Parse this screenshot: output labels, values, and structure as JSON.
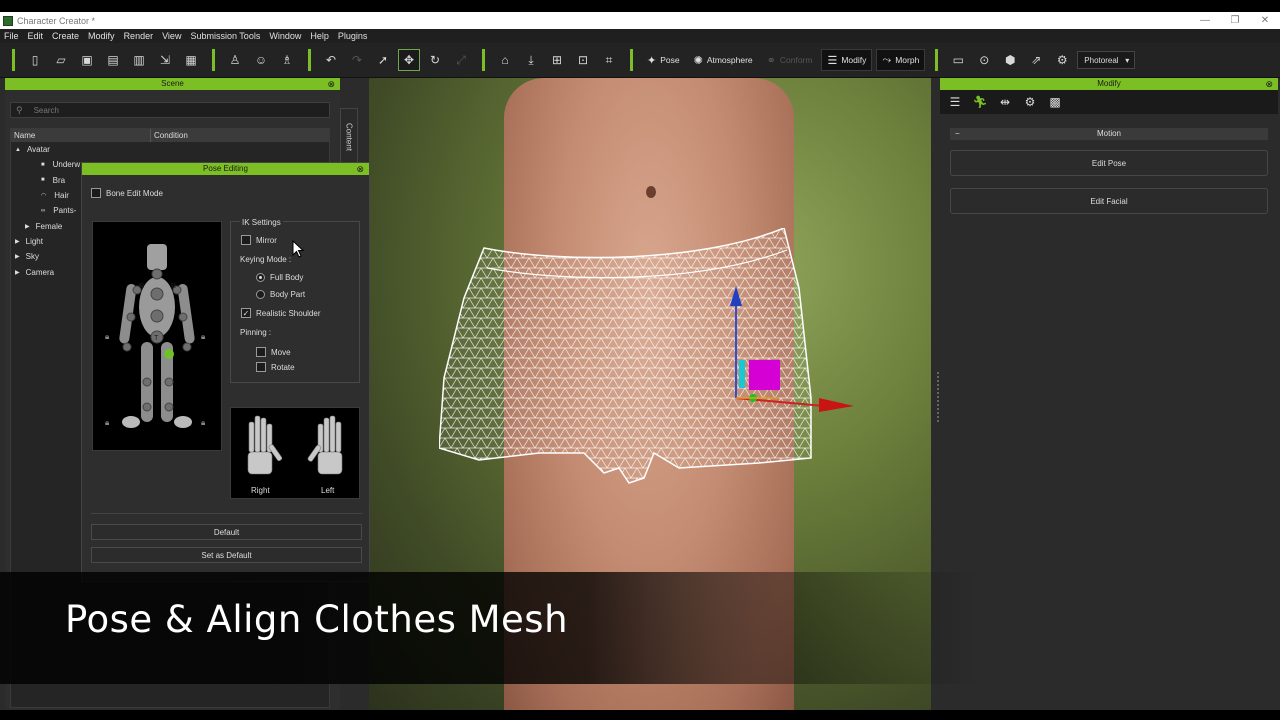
{
  "window": {
    "title": "Character Creator *",
    "controls": [
      "—",
      "❐",
      "✕"
    ]
  },
  "menu": [
    "File",
    "Edit",
    "Create",
    "Modify",
    "Render",
    "View",
    "Submission Tools",
    "Window",
    "Help",
    "Plugins"
  ],
  "toolbar": {
    "pose_label": "Pose",
    "atmosphere_label": "Atmosphere",
    "conform_label": "Conform",
    "modify_label": "Modify",
    "morph_label": "Morph",
    "render_mode": "Photoreal"
  },
  "scene": {
    "title": "Scene",
    "search_placeholder": "Search",
    "content_tab": "Content",
    "columns": [
      "Name",
      "Condition"
    ],
    "rows": [
      {
        "label": "Avatar",
        "indent": 0,
        "icon": "▲"
      },
      {
        "label": "Underw",
        "indent": 2,
        "icon": "■"
      },
      {
        "label": "Bra",
        "indent": 2,
        "icon": "■"
      },
      {
        "label": "Hair",
        "indent": 2,
        "icon": "◠"
      },
      {
        "label": "Pants-",
        "indent": 2,
        "icon": "∞"
      },
      {
        "label": "Female",
        "indent": 1,
        "icon": "▶"
      },
      {
        "label": "Light",
        "indent": 0,
        "icon": "▶"
      },
      {
        "label": "Sky",
        "indent": 0,
        "icon": "▶"
      },
      {
        "label": "Camera",
        "indent": 0,
        "icon": "▶"
      }
    ]
  },
  "pose_editing": {
    "title": "Pose Editing",
    "bone_edit_mode": "Bone Edit Mode",
    "ik_settings": "IK Settings",
    "mirror": "Mirror",
    "keying_mode": "Keying Mode :",
    "full_body": "Full Body",
    "body_part": "Body Part",
    "realistic_shoulder": "Realistic Shoulder",
    "pinning": "Pinning :",
    "move": "Move",
    "rotate": "Rotate",
    "right_hand": "Right",
    "left_hand": "Left",
    "default_button": "Default",
    "set_default_button": "Set as Default"
  },
  "modify": {
    "title": "Modify",
    "motion": "Motion",
    "edit_pose": "Edit Pose",
    "edit_facial": "Edit Facial"
  },
  "caption": "Pose & Align Clothes Mesh",
  "colors": {
    "accent": "#7cbf24",
    "panel": "#2e2e2e",
    "gizmo_magenta": "#d400d4",
    "gizmo_cyan": "#19c8d2"
  }
}
